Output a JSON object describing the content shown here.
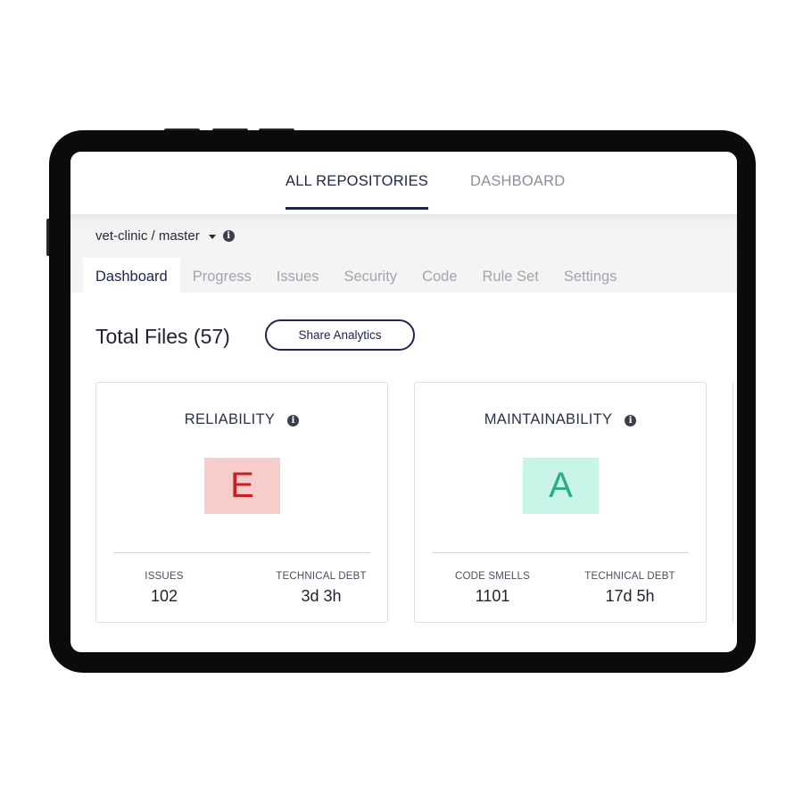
{
  "top_nav": {
    "tabs": [
      {
        "label": "ALL REPOSITORIES",
        "active": true
      },
      {
        "label": "DASHBOARD",
        "active": false
      }
    ]
  },
  "repo": {
    "name": "vet-clinic / master",
    "info_icon": "info-icon"
  },
  "sub_tabs": [
    {
      "label": "Dashboard",
      "active": true
    },
    {
      "label": "Progress",
      "active": false
    },
    {
      "label": "Issues",
      "active": false
    },
    {
      "label": "Security",
      "active": false
    },
    {
      "label": "Code",
      "active": false
    },
    {
      "label": "Rule Set",
      "active": false
    },
    {
      "label": "Settings",
      "active": false
    }
  ],
  "main": {
    "total_files": "Total Files (57)",
    "share_button": "Share Analytics"
  },
  "cards": [
    {
      "title": "RELIABILITY",
      "grade": "E",
      "grade_color": "#c8201e",
      "grade_bg": "#f6cdcb",
      "metrics": [
        {
          "label": "ISSUES",
          "value": "102"
        },
        {
          "label": "TECHNICAL DEBT",
          "value": "3d 3h"
        }
      ]
    },
    {
      "title": "MAINTAINABILITY",
      "grade": "A",
      "grade_color": "#28ad8c",
      "grade_bg": "#c8f5e7",
      "metrics": [
        {
          "label": "CODE SMELLS",
          "value": "1101"
        },
        {
          "label": "TECHNICAL DEBT",
          "value": "17d 5h"
        }
      ]
    }
  ],
  "colors": {
    "accent": "#22264d",
    "frame": "#0b0b0b"
  }
}
